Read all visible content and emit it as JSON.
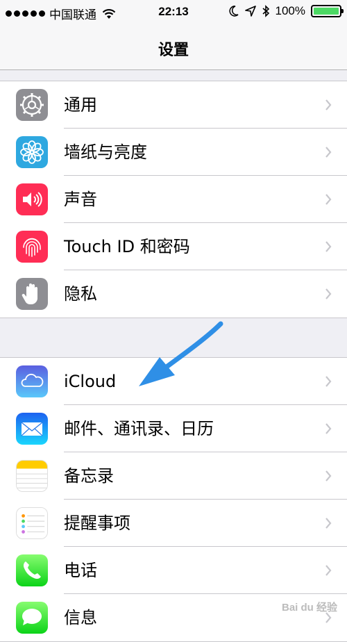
{
  "status_bar": {
    "carrier": "中国联通",
    "time": "22:13",
    "battery_percent": "100%",
    "battery_level": 1.0,
    "icons": [
      "signal-dots-icon",
      "wifi-icon",
      "moon-icon",
      "location-arrow-icon",
      "bluetooth-icon",
      "battery-icon"
    ]
  },
  "nav": {
    "title": "设置"
  },
  "groups": [
    {
      "rows": [
        {
          "label": "通用",
          "icon": "gear-icon",
          "color": "#8e8e93"
        },
        {
          "label": "墙纸与亮度",
          "icon": "flower-icon",
          "color": "#2ea8e0"
        },
        {
          "label": "声音",
          "icon": "speaker-icon",
          "color": "#ff2d55"
        },
        {
          "label": "Touch ID 和密码",
          "icon": "fingerprint-icon",
          "color": "#ff2d55"
        },
        {
          "label": "隐私",
          "icon": "hand-icon",
          "color": "#8e8e93"
        }
      ]
    },
    {
      "rows": [
        {
          "label": "iCloud",
          "icon": "cloud-icon",
          "color": "#3f8ff0"
        },
        {
          "label": "邮件、通讯录、日历",
          "icon": "mail-icon",
          "color": "#1a8cf6"
        },
        {
          "label": "备忘录",
          "icon": "notes-icon",
          "color": "#ffcc00"
        },
        {
          "label": "提醒事项",
          "icon": "reminders-icon",
          "color": "#ffffff"
        },
        {
          "label": "电话",
          "icon": "phone-icon",
          "color": "#4cd964"
        },
        {
          "label": "信息",
          "icon": "message-icon",
          "color": "#4cd964"
        }
      ]
    }
  ],
  "annotation": {
    "icon": "blue-arrow-icon",
    "color": "#2f8fe6"
  },
  "watermark": "Bai du 经验"
}
